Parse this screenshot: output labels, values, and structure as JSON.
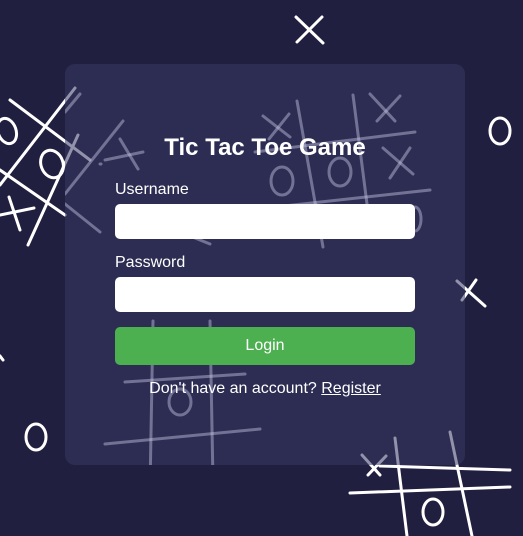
{
  "app": {
    "title": "Tic Tac Toe Game"
  },
  "form": {
    "username_label": "Username",
    "username_value": "",
    "password_label": "Password",
    "password_value": "",
    "login_label": "Login",
    "register_prompt": "Don't have an account?",
    "register_link": "Register"
  },
  "colors": {
    "background": "#211f3f",
    "card": "#30305a",
    "accent_green": "#4caf50",
    "text": "#ffffff"
  }
}
